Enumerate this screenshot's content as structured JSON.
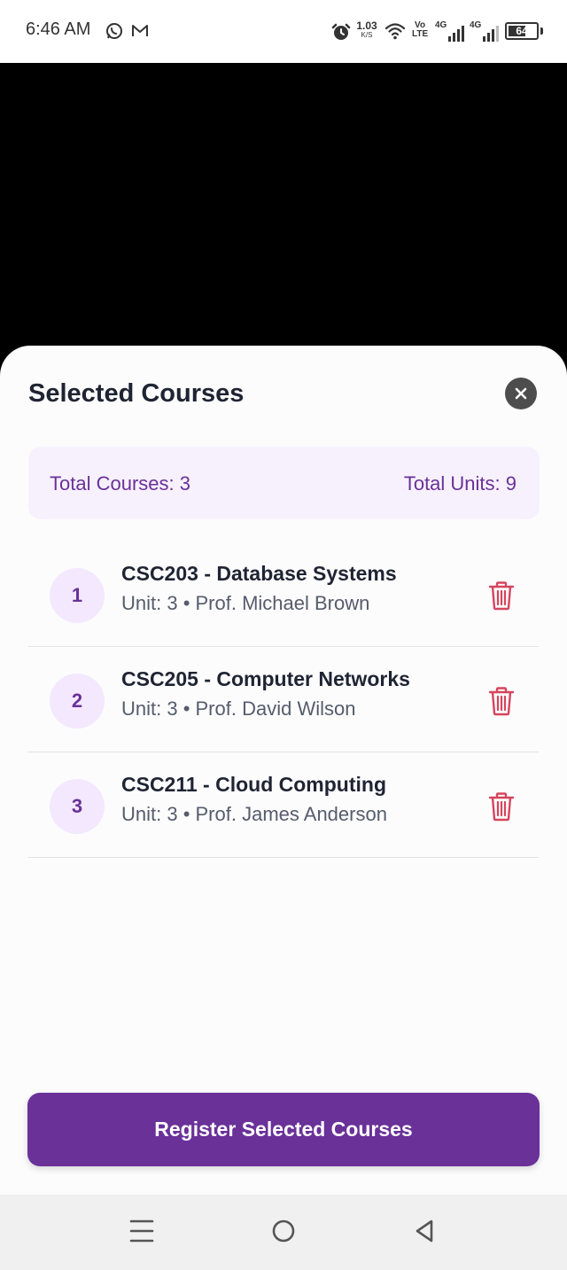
{
  "status_bar": {
    "time": "6:46 AM",
    "net_speed_value": "1.03",
    "net_speed_unit": "K/S",
    "volte_top": "Vo",
    "volte_bottom": "LTE",
    "sim1_network": "4G",
    "sim2_network": "4G",
    "battery": "64",
    "battery_level": 0.64,
    "icons": [
      "whatsapp-icon",
      "gmail-icon",
      "alarm-icon",
      "wifi-icon",
      "signal-icon",
      "battery-icon"
    ]
  },
  "sheet": {
    "title": "Selected Courses",
    "close_icon": "close-icon",
    "summary": {
      "total_courses": "Total Courses: 3",
      "total_units": "Total Units: 9"
    },
    "courses": [
      {
        "index": "1",
        "title": "CSC203 - Database Systems",
        "subtitle": "Unit: 3 • Prof. Michael Brown"
      },
      {
        "index": "2",
        "title": "CSC205 - Computer Networks",
        "subtitle": "Unit: 3 • Prof. David Wilson"
      },
      {
        "index": "3",
        "title": "CSC211 - Cloud Computing",
        "subtitle": "Unit: 3 • Prof. James Anderson"
      }
    ],
    "register_label": "Register Selected Courses"
  },
  "nav_bar": {
    "icons": [
      "menu-icon",
      "home-icon",
      "back-icon"
    ]
  },
  "colors": {
    "accent": "#6a3199",
    "summary_bg": "#f7f1fd",
    "index_bg": "#f3e8fd",
    "delete": "#d6455d",
    "title_text": "#1f2433"
  }
}
